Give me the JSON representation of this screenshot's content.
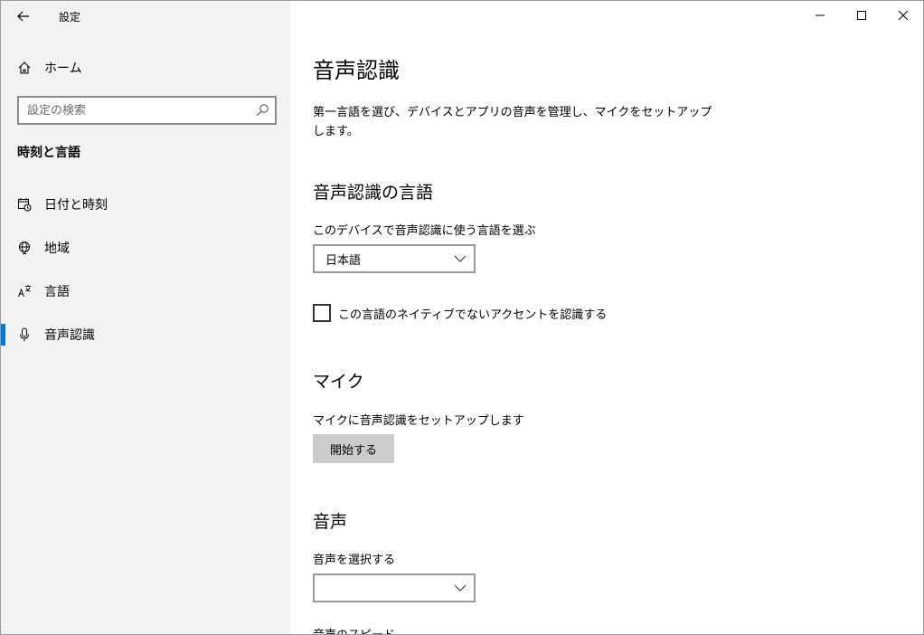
{
  "window": {
    "title": "設定",
    "controls": {
      "minimize": "minimize-icon",
      "maximize": "maximize-icon",
      "close": "close-icon"
    }
  },
  "sidebar": {
    "home_label": "ホーム",
    "search": {
      "placeholder": "設定の検索",
      "value": ""
    },
    "section_heading": "時刻と言語",
    "items": [
      {
        "label": "日付と時刻",
        "icon": "calendar-clock-icon"
      },
      {
        "label": "地域",
        "icon": "globe-icon"
      },
      {
        "label": "言語",
        "icon": "language-icon"
      },
      {
        "label": "音声認識",
        "icon": "microphone-icon",
        "selected": true
      }
    ],
    "accent_color": "#0078d7"
  },
  "main": {
    "title": "音声認識",
    "description": "第一言語を選び、デバイスとアプリの音声を管理し、マイクをセットアップします。",
    "speech_language": {
      "heading": "音声認識の言語",
      "label": "このデバイスで音声認識に使う言語を選ぶ",
      "selected": "日本語",
      "checkbox_label": "この言語のネイティブでないアクセントを認識する",
      "checkbox_checked": false
    },
    "microphone": {
      "heading": "マイク",
      "label": "マイクに音声認識をセットアップします",
      "button": "開始する"
    },
    "voice": {
      "heading": "音声",
      "label": "音声を選択する",
      "selected": "",
      "next_label": "音声のスピード"
    }
  }
}
